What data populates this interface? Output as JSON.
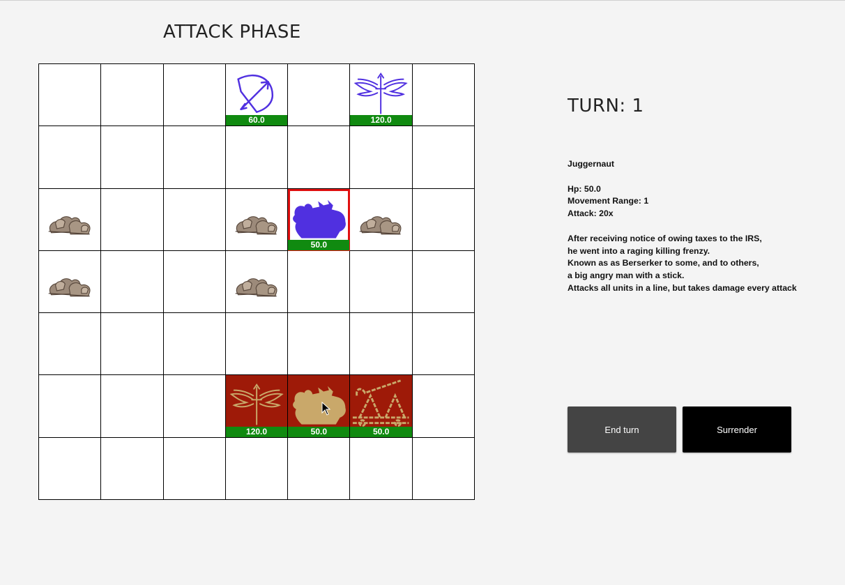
{
  "phase_title": "ATTACK PHASE",
  "turn_label": "TURN: 1",
  "colors": {
    "player_unit": "#5030e0",
    "enemy_tile": "#9e1a08",
    "enemy_unit": "#c9a86a",
    "hp_bar": "#108a10",
    "selection": "#e01010"
  },
  "board": {
    "rows": 7,
    "cols": 7,
    "pieces": [
      {
        "row": 0,
        "col": 3,
        "unit": "archer",
        "icon": "bow-icon",
        "team": "player",
        "hp": "60.0"
      },
      {
        "row": 0,
        "col": 5,
        "unit": "winged-sword",
        "icon": "winged-sword-icon",
        "team": "player",
        "hp": "120.0"
      },
      {
        "row": 2,
        "col": 0,
        "terrain": "rocks",
        "icon": "rocks-icon"
      },
      {
        "row": 2,
        "col": 3,
        "terrain": "rocks",
        "icon": "rocks-icon"
      },
      {
        "row": 2,
        "col": 4,
        "unit": "juggernaut",
        "icon": "juggernaut-icon",
        "team": "player",
        "hp": "50.0",
        "selected": true
      },
      {
        "row": 2,
        "col": 5,
        "terrain": "rocks",
        "icon": "rocks-icon"
      },
      {
        "row": 3,
        "col": 0,
        "terrain": "rocks",
        "icon": "rocks-icon"
      },
      {
        "row": 3,
        "col": 3,
        "terrain": "rocks",
        "icon": "rocks-icon"
      },
      {
        "row": 5,
        "col": 3,
        "unit": "winged-sword",
        "icon": "winged-sword-icon",
        "team": "enemy",
        "hp": "120.0"
      },
      {
        "row": 5,
        "col": 4,
        "unit": "juggernaut",
        "icon": "juggernaut-icon",
        "team": "enemy",
        "hp": "50.0",
        "cursor": true
      },
      {
        "row": 5,
        "col": 5,
        "unit": "catapult",
        "icon": "catapult-icon",
        "team": "enemy",
        "hp": "50.0"
      }
    ]
  },
  "unit_info": {
    "name": "Juggernaut",
    "hp": "Hp: 50.0",
    "movement_range": "Movement Range: 1",
    "attack": "Attack: 20x",
    "description": [
      "After receiving notice of owing taxes to the IRS,",
      "he went into a raging killing frenzy.",
      "Known as as Berserker to some, and to others,",
      "a big angry man with a stick.",
      "Attacks all units in a line, but takes damage every attack"
    ]
  },
  "buttons": {
    "end_turn": "End turn",
    "surrender": "Surrender"
  }
}
